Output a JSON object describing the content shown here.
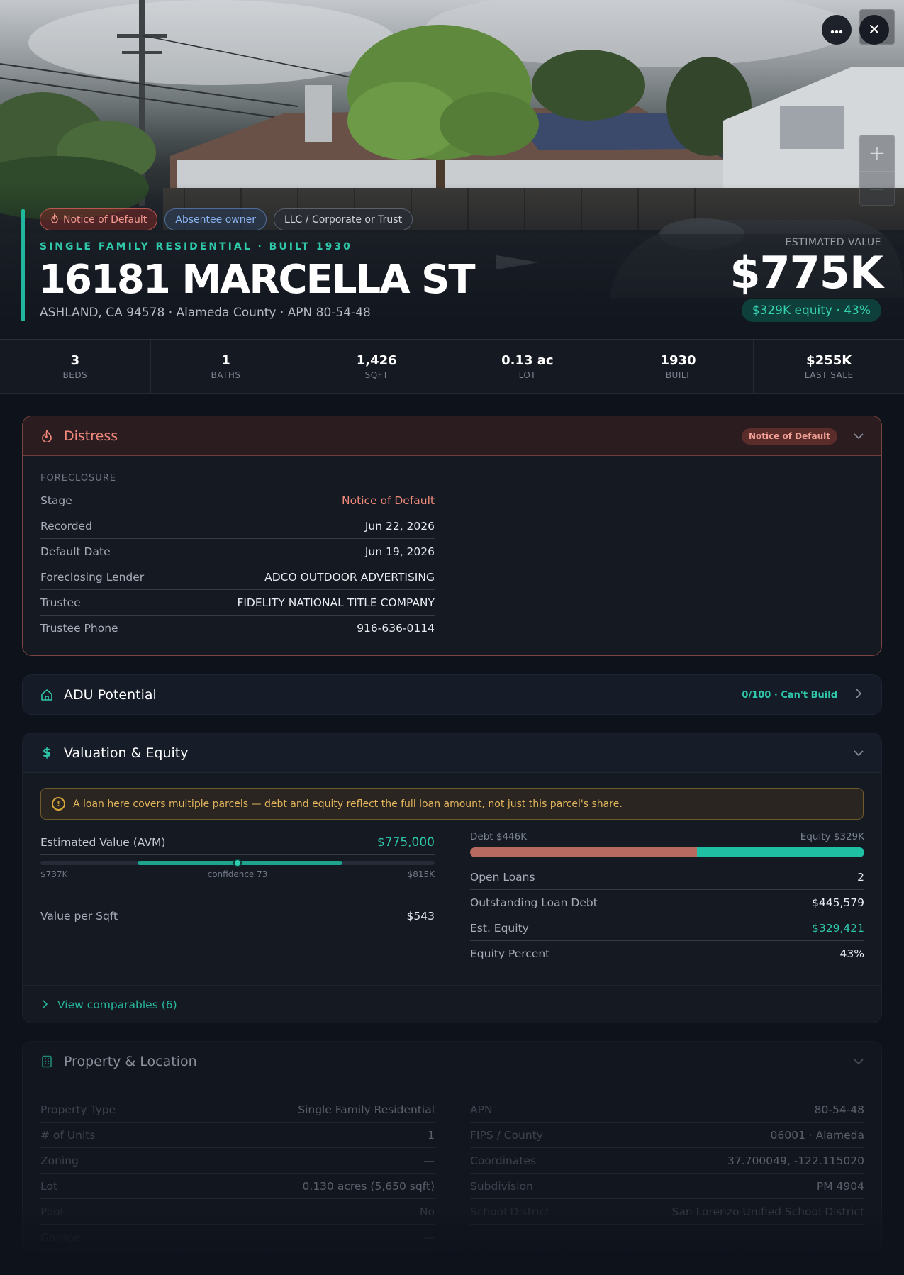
{
  "hero": {
    "badges": [
      "Notice of Default",
      "Absentee owner",
      "LLC / Corporate or Trust"
    ],
    "subtitle": "SINGLE FAMILY RESIDENTIAL · BUILT 1930",
    "address": "16181 MARCELLA ST",
    "address_sub": "ASHLAND, CA 94578 · Alameda County · APN 80-54-48",
    "estimated_value_label": "ESTIMATED VALUE",
    "estimated_value": "$775K",
    "equity_pill": "$329K equity · 43%",
    "zoom_in": "+",
    "zoom_out": "−"
  },
  "stats": [
    {
      "value": "3",
      "label": "BEDS"
    },
    {
      "value": "1",
      "label": "BATHS"
    },
    {
      "value": "1,426",
      "label": "SQFT"
    },
    {
      "value": "0.13 ac",
      "label": "LOT"
    },
    {
      "value": "1930",
      "label": "BUILT"
    },
    {
      "value": "$255K",
      "label": "LAST SALE"
    }
  ],
  "distress": {
    "title": "Distress",
    "tag": "Notice of Default",
    "section": "FORECLOSURE",
    "rows": [
      {
        "k": "Stage",
        "v": "Notice of Default"
      },
      {
        "k": "Recorded",
        "v": "Jun 22, 2026"
      },
      {
        "k": "Default Date",
        "v": "Jun 19, 2026"
      },
      {
        "k": "Foreclosing Lender",
        "v": "ADCO OUTDOOR ADVERTISING"
      },
      {
        "k": "Trustee",
        "v": "FIDELITY NATIONAL TITLE COMPANY"
      },
      {
        "k": "Trustee Phone",
        "v": "916-636-0114"
      }
    ]
  },
  "adu": {
    "title": "ADU Potential",
    "tag": "0/100 · Can't Build"
  },
  "valuation": {
    "title": "Valuation & Equity",
    "notice": "A loan here covers multiple parcels — debt and equity reflect the full loan amount, not just this parcel's share.",
    "avm_label": "Estimated Value (AVM)",
    "avm_value": "$775,000",
    "range_low": "$737K",
    "range_high": "$815K",
    "confidence": "confidence 73",
    "range": {
      "min": 700,
      "max": 850,
      "low": 737,
      "high": 815,
      "value": 775
    },
    "vps_label": "Value per Sqft",
    "vps_value": "$543",
    "debt_label": "Debt $446K",
    "equity_label": "Equity $329K",
    "debt_fraction": 0.575,
    "rows": [
      {
        "k": "Open Loans",
        "v": "2"
      },
      {
        "k": "Outstanding Loan Debt",
        "v": "$445,579"
      },
      {
        "k": "Est. Equity",
        "v": "$329,421"
      },
      {
        "k": "Equity Percent",
        "v": "43%"
      }
    ],
    "comparables": "View comparables (6)"
  },
  "property": {
    "title": "Property & Location",
    "left": [
      {
        "k": "Property Type",
        "v": "Single Family Residential"
      },
      {
        "k": "# of Units",
        "v": "1"
      },
      {
        "k": "Zoning",
        "v": "—"
      },
      {
        "k": "Lot",
        "v": "0.130 acres (5,650 sqft)"
      },
      {
        "k": "Pool",
        "v": "No"
      },
      {
        "k": "Garage",
        "v": "—"
      }
    ],
    "right": [
      {
        "k": "APN",
        "v": "80-54-48"
      },
      {
        "k": "FIPS / County",
        "v": "06001 · Alameda"
      },
      {
        "k": "Coordinates",
        "v": "37.700049, -122.115020"
      },
      {
        "k": "Subdivision",
        "v": "PM 4904"
      },
      {
        "k": "School District",
        "v": "San Lorenzo Unified School District"
      }
    ]
  },
  "colors": {
    "accent": "#1fb89f",
    "distress": "#f2877b",
    "debt": "#b66a60",
    "equity": "#1fbfa3"
  }
}
